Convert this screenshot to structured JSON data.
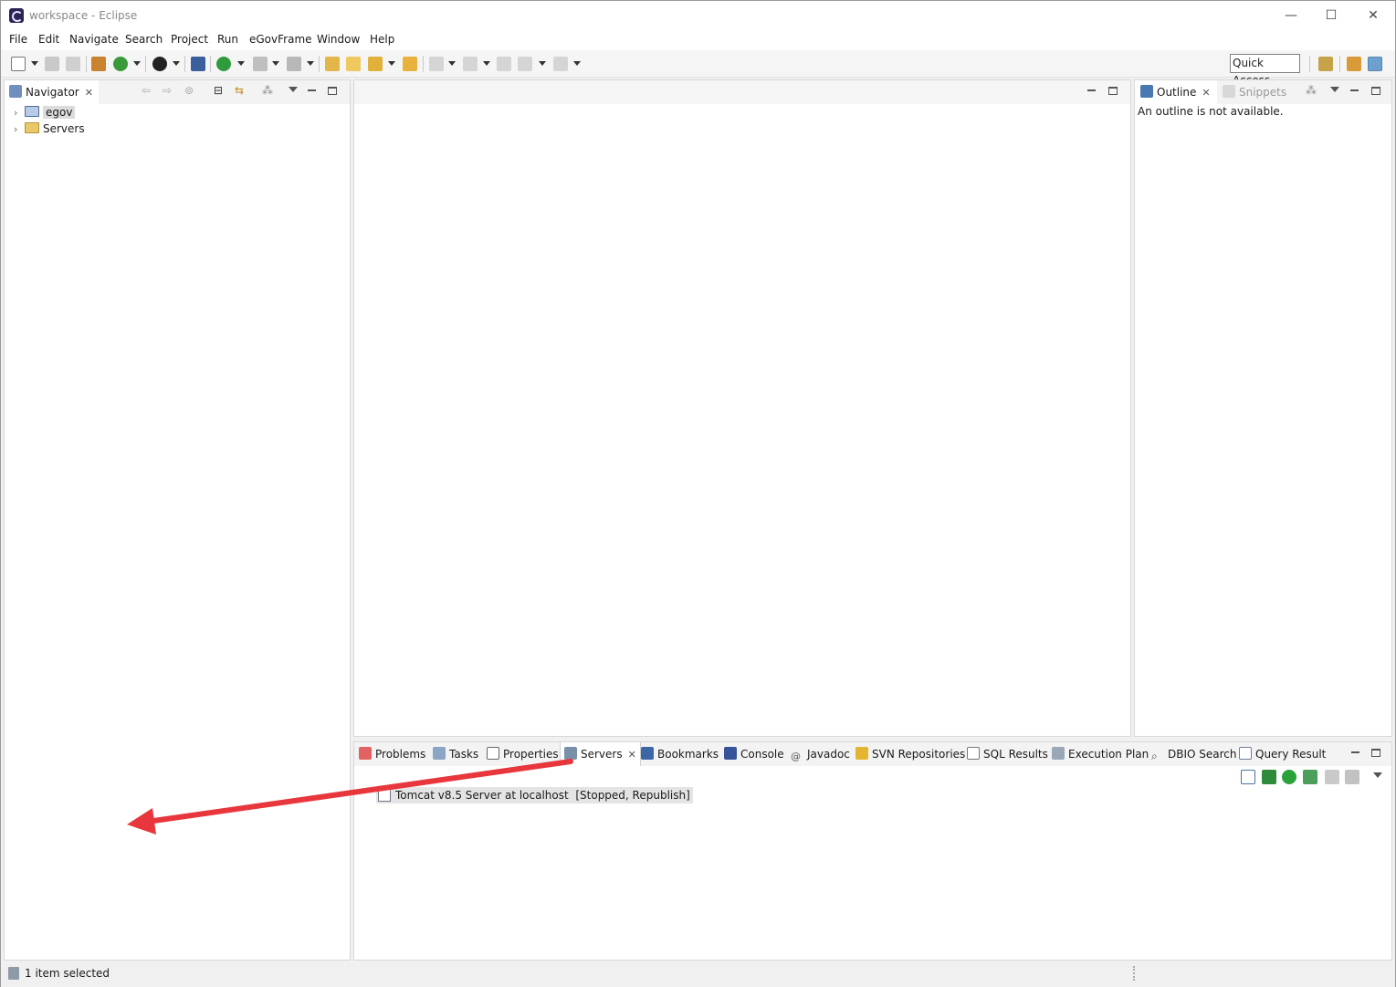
{
  "window": {
    "title": "workspace - Eclipse",
    "minimize": "—",
    "maximize": "☐",
    "close": "✕"
  },
  "menu": [
    "File",
    "Edit",
    "Navigate",
    "Search",
    "Project",
    "Run",
    "eGovFrame",
    "Window",
    "Help"
  ],
  "toolbar": {
    "quick_access": "Quick Access"
  },
  "navigator": {
    "tab_label": "Navigator",
    "items": [
      {
        "label": "egov",
        "expander": "›",
        "selected": true,
        "icon": "project-folder-icon"
      },
      {
        "label": "Servers",
        "expander": "›",
        "selected": false,
        "icon": "folder-icon"
      }
    ]
  },
  "outline": {
    "tabs": [
      {
        "label": "Outline"
      },
      {
        "label": "Snippets"
      }
    ],
    "message": "An outline is not available."
  },
  "bottom": {
    "tabs": [
      {
        "label": "Problems",
        "icon": "problems-icon"
      },
      {
        "label": "Tasks",
        "icon": "tasks-icon"
      },
      {
        "label": "Properties",
        "icon": "properties-icon"
      },
      {
        "label": "Servers",
        "icon": "servers-icon",
        "active": true
      },
      {
        "label": "Bookmarks",
        "icon": "bookmarks-icon"
      },
      {
        "label": "Console",
        "icon": "console-icon"
      },
      {
        "label": "Javadoc",
        "icon": "javadoc-icon"
      },
      {
        "label": "SVN Repositories",
        "icon": "svn-icon"
      },
      {
        "label": "SQL Results",
        "icon": "sql-results-icon"
      },
      {
        "label": "Execution Plan",
        "icon": "execution-plan-icon"
      },
      {
        "label": "DBIO Search",
        "icon": "search-icon"
      },
      {
        "label": "Query Result",
        "icon": "table-icon"
      }
    ],
    "servers": [
      {
        "name": "Tomcat v8.5 Server at localhost",
        "state": "[Stopped, Republish]"
      }
    ]
  },
  "status": {
    "text": "1 item selected"
  },
  "annotation": {
    "arrow_color": "#e8363d"
  }
}
